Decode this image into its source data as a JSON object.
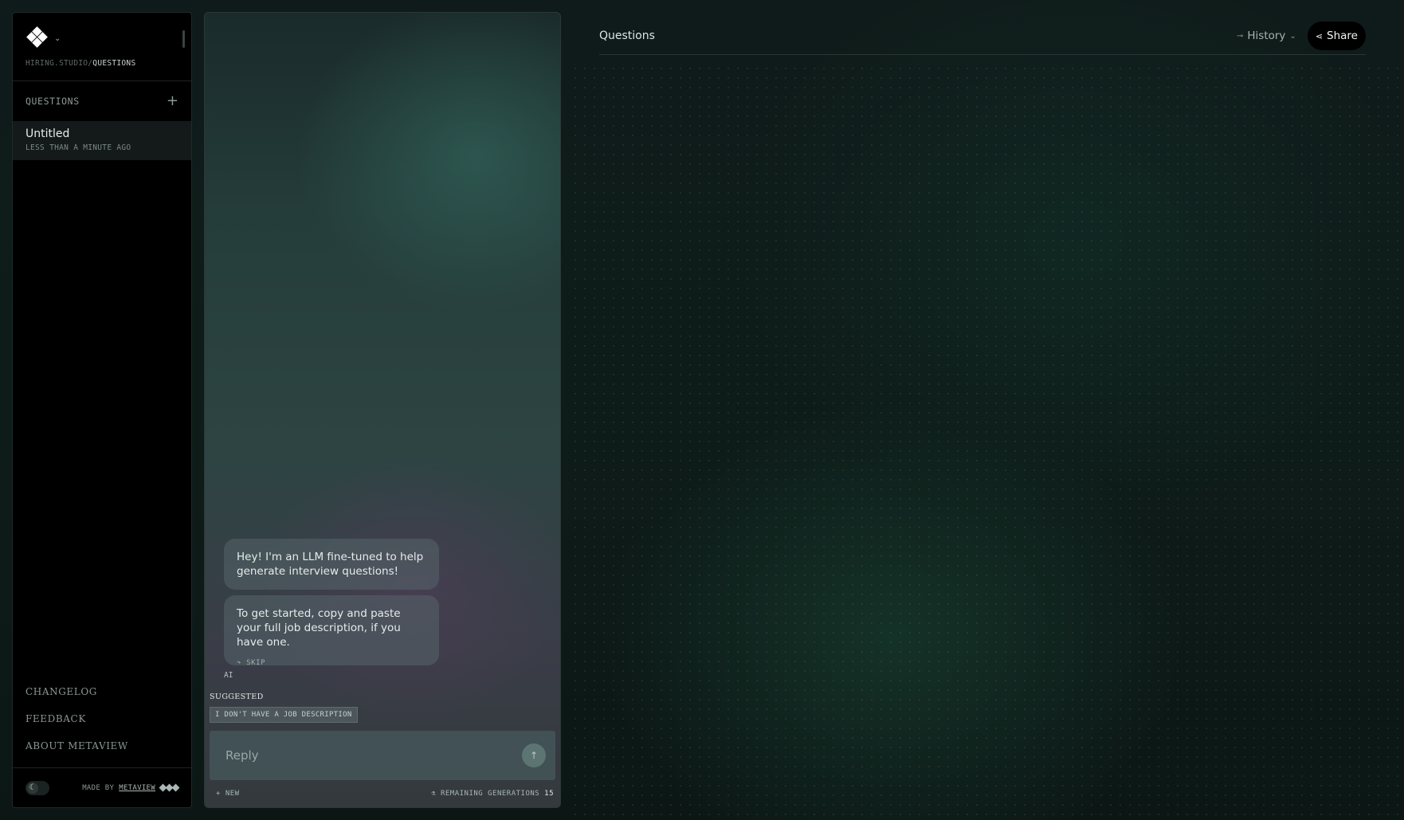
{
  "sidebar": {
    "breadcrumb_prefix": "HIRING.STUDIO",
    "breadcrumb_current": "QUESTIONS",
    "section_title": "QUESTIONS",
    "add_icon": "plus-icon",
    "items": [
      {
        "title": "Untitled",
        "time": "LESS THAN A MINUTE AGO"
      }
    ],
    "links": [
      "CHANGELOG",
      "FEEDBACK",
      "ABOUT METAVIEW"
    ],
    "made_by_prefix": "MADE BY",
    "made_by_link": "METAVIEW"
  },
  "chat": {
    "messages": [
      "Hey! I'm an LLM fine-tuned to help generate interview questions!",
      "To get started, copy and paste your full job description, if you have one."
    ],
    "skip_label": "SKIP",
    "sender_label": "AI",
    "suggested_title": "SUGGESTED",
    "suggested_chip": "I DON'T HAVE A JOB DESCRIPTION",
    "reply_placeholder": "Reply",
    "new_label": "NEW",
    "remaining_label": "REMAINING GENERATIONS",
    "remaining_count": "15"
  },
  "main": {
    "title": "Questions",
    "history_label": "History",
    "share_label": "Share"
  },
  "colors": {
    "background": "#0f1a19",
    "sidebar": "#000000",
    "accent": "#5d7572"
  }
}
